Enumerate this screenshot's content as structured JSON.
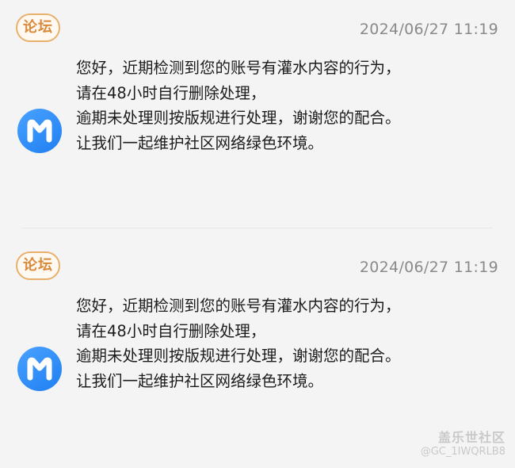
{
  "notices": [
    {
      "tag": "论坛",
      "timestamp": "2024/06/27 11:19",
      "avatar_icon": "m-logo-icon",
      "lines": [
        "您好，近期检测到您的账号有灌水内容的行为，",
        "请在48小时自行删除处理，",
        "逾期未处理则按版规进行处理，谢谢您的配合。",
        "让我们一起维护社区网络绿色环境。"
      ]
    },
    {
      "tag": "论坛",
      "timestamp": "2024/06/27 11:19",
      "avatar_icon": "m-logo-icon",
      "lines": [
        "您好，近期检测到您的账号有灌水内容的行为，",
        "请在48小时自行删除处理，",
        "逾期未处理则按版规进行处理，谢谢您的配合。",
        "让我们一起维护社区网络绿色环境。"
      ]
    }
  ],
  "watermark": {
    "brand": "盖乐世社区",
    "user": "@GC_1IWQRLB8"
  },
  "colors": {
    "background": "#f4f4f4",
    "tag_border": "#e8b06d",
    "tag_text": "#d88a3a",
    "avatar_blue": "#2f8ff7",
    "timestamp": "#8a8a8a"
  }
}
